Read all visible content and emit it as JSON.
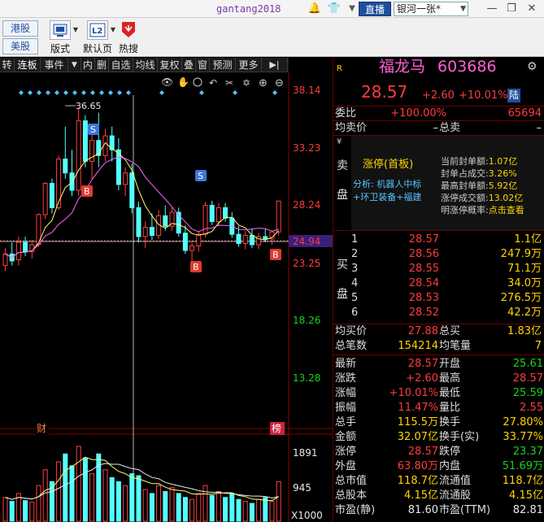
{
  "titlebar": {
    "username": "gantang2018",
    "live_label": "直播",
    "account_label": "银河一张*"
  },
  "toolbar": {
    "market_buttons": [
      "港股",
      "美股"
    ],
    "items": [
      {
        "label": "版式",
        "icon": "layout-icon"
      },
      {
        "label": "默认页",
        "icon": "l2-page-icon",
        "icon_text": "L2"
      },
      {
        "label": "热搜",
        "icon": "hot-search-icon"
      }
    ]
  },
  "chart_tabs": [
    "转",
    "连板",
    "事件",
    "▼",
    "内",
    "删",
    "自选",
    "均线",
    "复权",
    "叠",
    "窗",
    "预测",
    "更多",
    "▶|"
  ],
  "chart_tools": [
    "eye-icon",
    "hand-icon",
    "play-icon",
    "undo-icon",
    "scissors-icon",
    "plus-icon",
    "minus-icon"
  ],
  "price_axis": [
    "38.14",
    "33.23",
    "28.24",
    "24.94",
    "23.25",
    "18.26",
    "13.28"
  ],
  "volume_axis": [
    "1891",
    "945",
    "X1000"
  ],
  "annotations": {
    "high_value": "36.65",
    "markers_s": [
      "S",
      "S"
    ],
    "markers_b": [
      "B",
      "B",
      "B"
    ],
    "bottom_left": "财",
    "bottom_right": "榜"
  },
  "chart_data": {
    "type": "candlestick",
    "ylim": [
      13.28,
      38.14
    ],
    "current_line": 24.94,
    "candles": [
      {
        "o": 23.0,
        "h": 24.5,
        "l": 22.5,
        "c": 24.0,
        "up": true
      },
      {
        "o": 24.0,
        "h": 25.0,
        "l": 23.0,
        "c": 23.4,
        "up": false
      },
      {
        "o": 23.5,
        "h": 25.5,
        "l": 23.0,
        "c": 25.0,
        "up": true
      },
      {
        "o": 25.0,
        "h": 25.5,
        "l": 23.8,
        "c": 24.2,
        "up": false
      },
      {
        "o": 24.2,
        "h": 25.2,
        "l": 23.6,
        "c": 24.8,
        "up": true
      },
      {
        "o": 24.8,
        "h": 27.5,
        "l": 24.6,
        "c": 27.4,
        "up": true
      },
      {
        "o": 27.4,
        "h": 30.2,
        "l": 27.0,
        "c": 30.1,
        "up": true
      },
      {
        "o": 30.1,
        "h": 30.5,
        "l": 27.5,
        "c": 28.0,
        "up": false
      },
      {
        "o": 28.0,
        "h": 32.5,
        "l": 27.8,
        "c": 32.2,
        "up": true
      },
      {
        "o": 32.2,
        "h": 35.0,
        "l": 30.5,
        "c": 31.0,
        "up": false
      },
      {
        "o": 31.0,
        "h": 33.0,
        "l": 29.0,
        "c": 29.5,
        "up": false
      },
      {
        "o": 29.5,
        "h": 36.65,
        "l": 29.0,
        "c": 35.5,
        "up": true
      },
      {
        "o": 35.5,
        "h": 36.0,
        "l": 31.5,
        "c": 32.0,
        "up": false
      },
      {
        "o": 32.0,
        "h": 34.5,
        "l": 30.5,
        "c": 33.8,
        "up": true
      },
      {
        "o": 33.8,
        "h": 36.2,
        "l": 31.5,
        "c": 32.5,
        "up": false
      },
      {
        "o": 32.5,
        "h": 34.8,
        "l": 32.0,
        "c": 34.2,
        "up": true
      },
      {
        "o": 34.2,
        "h": 35.0,
        "l": 32.0,
        "c": 33.0,
        "up": false
      },
      {
        "o": 33.0,
        "h": 34.0,
        "l": 29.5,
        "c": 30.0,
        "up": false
      },
      {
        "o": 30.0,
        "h": 31.5,
        "l": 29.0,
        "c": 31.0,
        "up": true
      },
      {
        "o": 31.0,
        "h": 31.8,
        "l": 27.5,
        "c": 28.0,
        "up": false
      },
      {
        "o": 28.0,
        "h": 28.5,
        "l": 25.0,
        "c": 25.5,
        "up": false
      },
      {
        "o": 25.5,
        "h": 26.8,
        "l": 24.5,
        "c": 26.3,
        "up": true
      },
      {
        "o": 26.3,
        "h": 27.5,
        "l": 25.2,
        "c": 25.6,
        "up": false
      },
      {
        "o": 25.6,
        "h": 27.8,
        "l": 25.3,
        "c": 27.3,
        "up": true
      },
      {
        "o": 27.3,
        "h": 28.2,
        "l": 26.0,
        "c": 26.4,
        "up": false
      },
      {
        "o": 26.4,
        "h": 28.0,
        "l": 26.0,
        "c": 27.6,
        "up": true
      },
      {
        "o": 27.6,
        "h": 28.0,
        "l": 25.5,
        "c": 25.8,
        "up": false
      },
      {
        "o": 25.8,
        "h": 26.5,
        "l": 24.0,
        "c": 24.3,
        "up": false
      },
      {
        "o": 24.3,
        "h": 25.0,
        "l": 23.2,
        "c": 24.7,
        "up": true
      },
      {
        "o": 24.7,
        "h": 26.0,
        "l": 24.2,
        "c": 25.7,
        "up": true
      },
      {
        "o": 25.7,
        "h": 28.5,
        "l": 25.4,
        "c": 28.2,
        "up": true
      },
      {
        "o": 28.2,
        "h": 28.6,
        "l": 26.5,
        "c": 26.8,
        "up": false
      },
      {
        "o": 26.8,
        "h": 28.4,
        "l": 26.4,
        "c": 28.0,
        "up": true
      },
      {
        "o": 28.0,
        "h": 28.4,
        "l": 26.8,
        "c": 27.1,
        "up": false
      },
      {
        "o": 27.1,
        "h": 27.6,
        "l": 25.4,
        "c": 25.7,
        "up": false
      },
      {
        "o": 25.7,
        "h": 26.4,
        "l": 24.6,
        "c": 24.9,
        "up": false
      },
      {
        "o": 24.9,
        "h": 26.0,
        "l": 24.4,
        "c": 25.6,
        "up": true
      },
      {
        "o": 25.6,
        "h": 26.2,
        "l": 24.5,
        "c": 24.8,
        "up": false
      },
      {
        "o": 24.8,
        "h": 25.8,
        "l": 24.4,
        "c": 25.5,
        "up": true
      },
      {
        "o": 25.5,
        "h": 26.2,
        "l": 25.0,
        "c": 25.3,
        "up": false
      },
      {
        "o": 25.3,
        "h": 26.0,
        "l": 24.8,
        "c": 25.9,
        "up": true
      },
      {
        "o": 25.9,
        "h": 28.57,
        "l": 25.6,
        "c": 28.57,
        "up": true
      }
    ],
    "volumes": [
      600,
      500,
      700,
      520,
      480,
      900,
      1300,
      1000,
      1500,
      1700,
      1400,
      1891,
      1600,
      1200,
      1700,
      1300,
      1100,
      1000,
      900,
      1200,
      1150,
      800,
      700,
      900,
      750,
      850,
      700,
      600,
      550,
      700,
      900,
      650,
      750,
      600,
      700,
      550,
      500,
      450,
      550,
      600,
      500,
      1000
    ]
  },
  "quote": {
    "name": "福龙马",
    "code": "603686",
    "logo": "R",
    "price": "28.57",
    "change": "+2.60",
    "change_pct": "+10.01%",
    "badge": "陆",
    "weibi_label": "委比",
    "weibi_value": "+100.00%",
    "weibi_right": "65694",
    "ask_avg_label": "均卖价",
    "ask_avg_value": "–",
    "ask_total_label": "总卖",
    "ask_total_value": "–",
    "sell_label": [
      "卖",
      "盘"
    ],
    "limit_title": "涨停(首板)",
    "analysis": "分析: 机器人中标+环卫装备+福建",
    "limit_stats": [
      {
        "label": "当前封单额:",
        "value": "1.07亿"
      },
      {
        "label": "封单占成交:",
        "value": "3.26%"
      },
      {
        "label": "最高封单额:",
        "value": "5.92亿"
      },
      {
        "label": "涨停成交额:",
        "value": "13.02亿"
      },
      {
        "label": "明涨停概率:",
        "value": "点击查看"
      }
    ],
    "buy_label": [
      "买",
      "盘"
    ],
    "bids": [
      {
        "n": "1",
        "price": "28.57",
        "vol": "1.1亿"
      },
      {
        "n": "2",
        "price": "28.56",
        "vol": "247.9万"
      },
      {
        "n": "3",
        "price": "28.55",
        "vol": "71.1万"
      },
      {
        "n": "4",
        "price": "28.54",
        "vol": "34.0万"
      },
      {
        "n": "5",
        "price": "28.53",
        "vol": "276.5万"
      },
      {
        "n": "6",
        "price": "28.52",
        "vol": "42.2万"
      }
    ],
    "bid_avg_label": "均买价",
    "bid_avg_value": "27.88",
    "bid_total_label": "总买",
    "bid_total_value": "1.83亿",
    "total_trades_label": "总笔数",
    "total_trades_value": "154214",
    "avg_trade_label": "均笔量",
    "avg_trade_value": "7",
    "stats": [
      {
        "l1": "最新",
        "v1": "28.57",
        "c1": "red",
        "l2": "开盘",
        "v2": "25.61",
        "c2": "green"
      },
      {
        "l1": "涨跌",
        "v1": "+2.60",
        "c1": "red",
        "l2": "最高",
        "v2": "28.57",
        "c2": "red"
      },
      {
        "l1": "涨幅",
        "v1": "+10.01%",
        "c1": "red",
        "l2": "最低",
        "v2": "25.59",
        "c2": "green"
      },
      {
        "l1": "振幅",
        "v1": "11.47%",
        "c1": "red",
        "l2": "量比",
        "v2": "2.55",
        "c2": "red"
      },
      {
        "l1": "总手",
        "v1": "115.5万",
        "c1": "yellow",
        "l2": "换手",
        "v2": "27.80%",
        "c2": "yellow"
      },
      {
        "l1": "金额",
        "v1": "32.07亿",
        "c1": "yellow",
        "l2": "换手(实)",
        "v2": "33.77%",
        "c2": "yellow"
      },
      {
        "l1": "涨停",
        "v1": "28.57",
        "c1": "red",
        "l2": "跌停",
        "v2": "23.37",
        "c2": "green"
      },
      {
        "l1": "外盘",
        "v1": "63.80万",
        "c1": "red",
        "l2": "内盘",
        "v2": "51.69万",
        "c2": "green"
      },
      {
        "l1": "总市值",
        "v1": "118.7亿",
        "c1": "yellow",
        "l2": "流通值",
        "v2": "118.7亿",
        "c2": "yellow"
      },
      {
        "l1": "总股本",
        "v1": "4.15亿",
        "c1": "yellow",
        "l2": "流通股",
        "v2": "4.15亿",
        "c2": "yellow"
      },
      {
        "l1": "市盈(静)",
        "v1": "81.60",
        "c1": "white",
        "l2": "市盈(TTM)",
        "v2": "82.81",
        "c2": "white"
      }
    ]
  }
}
